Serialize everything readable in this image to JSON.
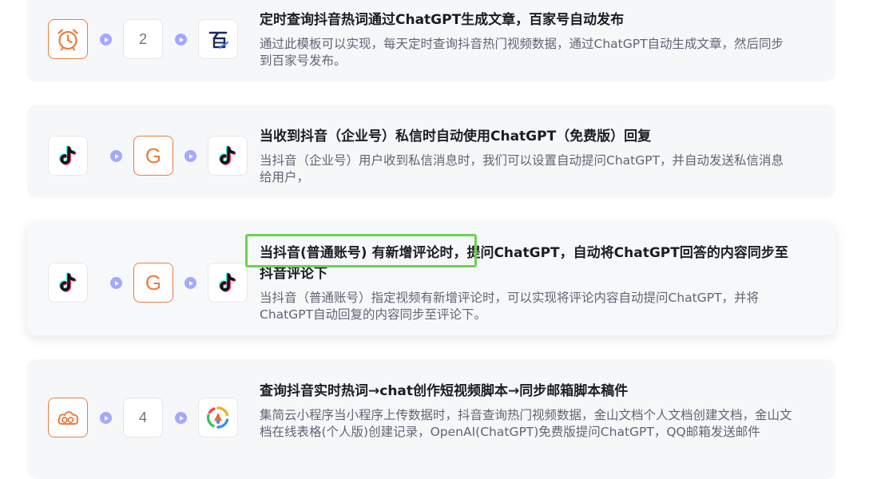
{
  "templates": [
    {
      "title": "定时查询抖音热词通过ChatGPT生成文章，百家号自动发布",
      "description": "通过此模板可以实现，每天定时查询抖音热门视频数据，通过ChatGPT自动生成文章，然后同步到百家号发布。",
      "step_count": "2",
      "icons": [
        "alarm-clock-icon",
        "baijiahao-icon"
      ]
    },
    {
      "title": "当收到抖音（企业号）私信时自动使用ChatGPT（免费版）回复",
      "description": "当抖音（企业号）用户收到私信消息时，我们可以设置自动提问ChatGPT，并自动发送私信消息给用户，",
      "icons": [
        "tiktok-icon",
        "chatgpt-g-icon",
        "tiktok-icon"
      ],
      "g_letter": "G"
    },
    {
      "title": "当抖音(普通账号) 有新增评论时，提问ChatGPT，自动将ChatGPT回答的内容同步至抖音评论下",
      "description": "当抖音（普通账号）指定视频有新增评论时，可以实现将评论内容自动提问ChatGPT，并将ChatGPT自动回复的内容同步至评论下。",
      "icons": [
        "tiktok-icon",
        "chatgpt-g-icon",
        "tiktok-icon"
      ],
      "g_letter": "G"
    },
    {
      "title": "查询抖音实时热词→chat创作短视频脚本→同步邮箱脚本稿件",
      "description": "集简云小程序当小程序上传数据时，抖音查询热门视频数据，金山文档个人文档创建文档，金山文档在线表格(个人版)创建记录，OpenAI(ChatGPT)免费版提问ChatGPT，QQ邮箱发送邮件",
      "step_count": "4",
      "icons": [
        "cloud-icon",
        "mini-program-icon"
      ]
    }
  ],
  "colors": {
    "accent_orange": "#ec7d3e",
    "arrow_purple": "#a3a8ff",
    "highlight_green": "#6cd352"
  }
}
